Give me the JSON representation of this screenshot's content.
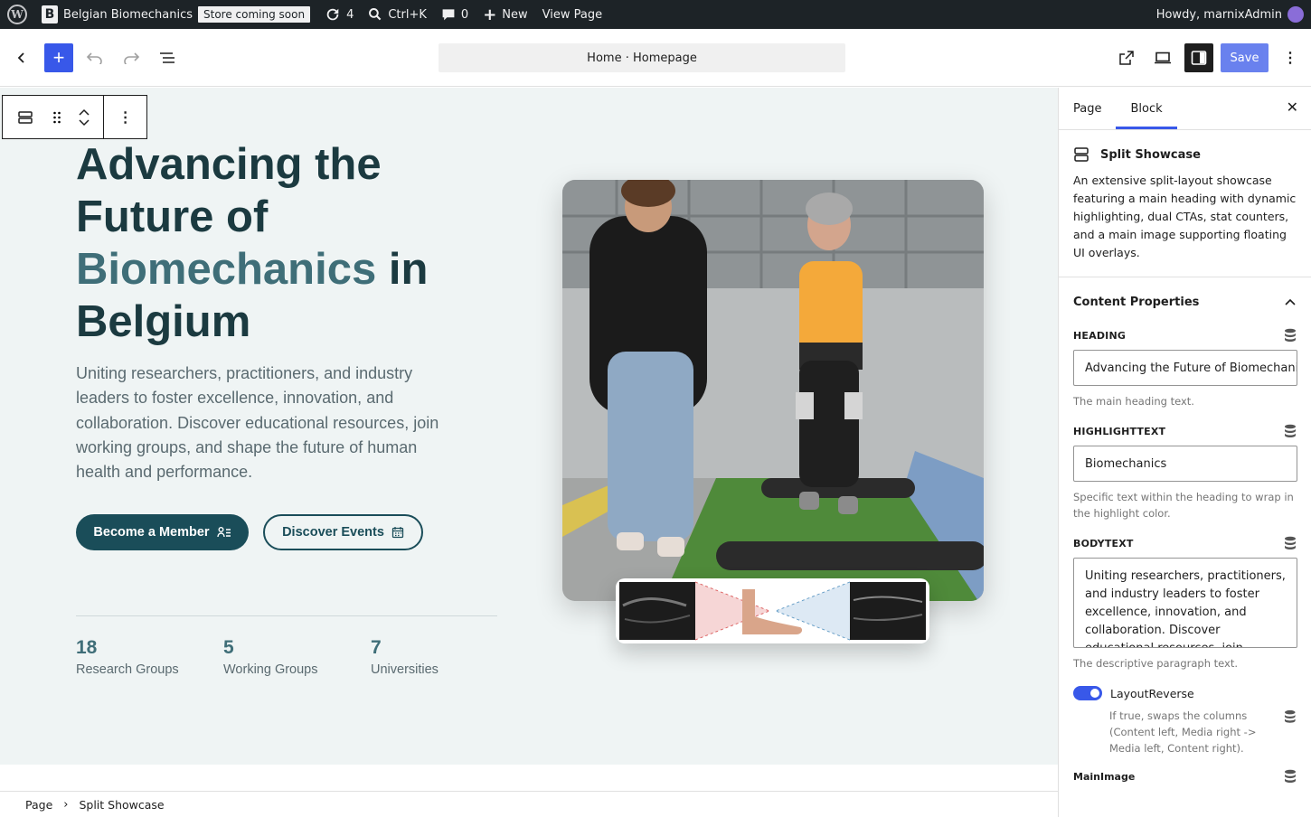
{
  "admin_bar": {
    "site_name": "Belgian Biomechanics",
    "site_icon_letter": "B",
    "store_badge": "Store coming soon",
    "updates_count": "4",
    "search_shortcut": "Ctrl+K",
    "comments_count": "0",
    "new_label": "New",
    "view_page_label": "View Page",
    "greeting": "Howdy, marnixAdmin"
  },
  "toolbar": {
    "document_title": "Home · Homepage",
    "save_label": "Save"
  },
  "hero": {
    "heading_line1": "Advancing the",
    "heading_line2": "Future of",
    "heading_highlight": "Biomechanics",
    "heading_after": " in",
    "heading_line4": "Belgium",
    "lead": "Uniting researchers, practitioners, and industry leaders to foster excellence, innovation, and collaboration. Discover educational resources, join working groups, and shape the future of human health and performance.",
    "primary_cta": "Become a Member",
    "secondary_cta": "Discover Events",
    "stats": [
      {
        "value": "18",
        "label": "Research Groups"
      },
      {
        "value": "5",
        "label": "Working Groups"
      },
      {
        "value": "7",
        "label": "Universities"
      }
    ]
  },
  "breadcrumbs": {
    "root": "Page",
    "current": "Split Showcase"
  },
  "sidebar": {
    "tabs": [
      "Page",
      "Block"
    ],
    "active_tab": "Block",
    "block_name": "Split Showcase",
    "block_description": "An extensive split-layout showcase featuring a main heading with dynamic highlighting, dual CTAs, stat counters, and a main image supporting floating UI overlays.",
    "panel_title": "Content Properties",
    "heading_label": "HEADING",
    "heading_value": "Advancing the Future of Biomechanics",
    "heading_help": "The main heading text.",
    "highlight_label": "HIGHLIGHTTEXT",
    "highlight_value": "Biomechanics",
    "highlight_help": "Specific text within the heading to wrap in the highlight color.",
    "body_label": "BODYTEXT",
    "body_value": "Uniting researchers, practitioners, and industry leaders to foster excellence, innovation, and collaboration. Discover educational resources, join working groups, and shape the future of human health and performance.",
    "body_help": "The descriptive paragraph text.",
    "layout_reverse_label": "LayoutReverse",
    "layout_reverse_on": true,
    "layout_reverse_help": "If true, swaps the columns (Content left, Media right -> Media left, Content right).",
    "main_image_label": "MainImage"
  },
  "colors": {
    "admin_bar": "#1d2327",
    "accent": "#3858e9",
    "hero_bg": "#eff4f4",
    "heading": "#1b3a40",
    "highlight": "#3f6e78",
    "primary_button": "#1a4d59"
  }
}
